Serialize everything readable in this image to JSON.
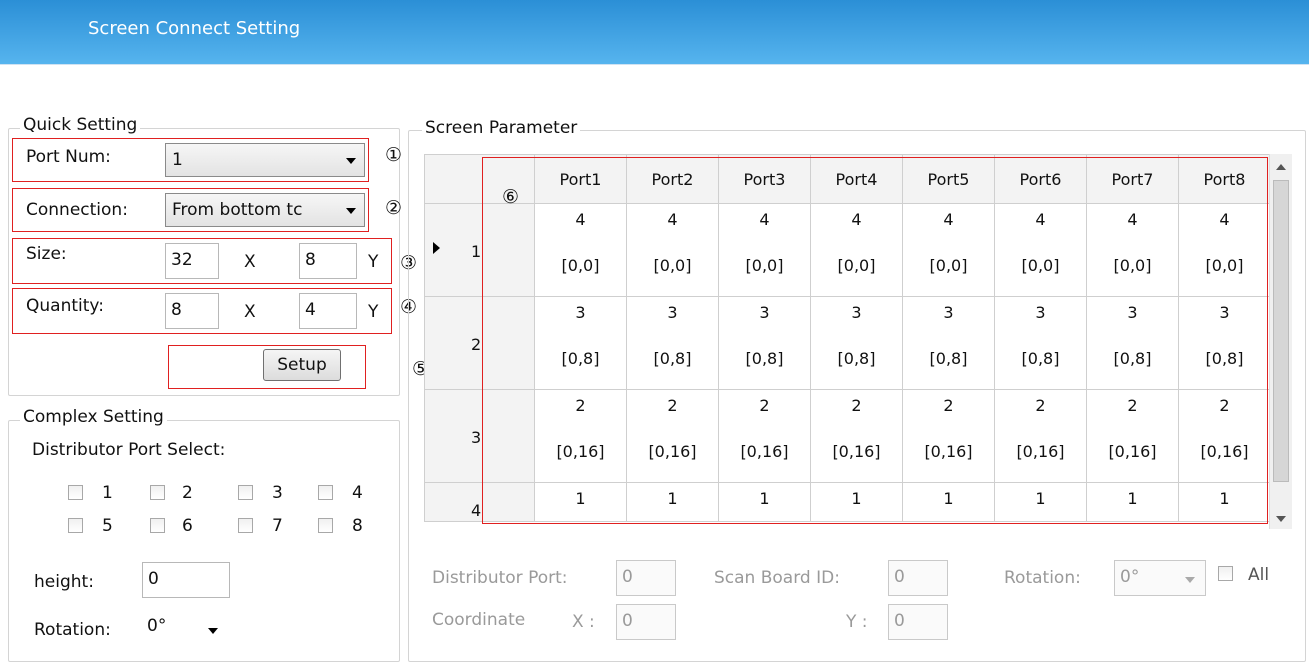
{
  "window": {
    "title": "Screen Connect Setting"
  },
  "quick": {
    "legend": "Quick  Setting",
    "port_num_label": "Port Num:",
    "port_num_value": "1",
    "connection_label": "Connection:",
    "connection_value": "From bottom tc",
    "size_label": "Size:",
    "size_x": "32",
    "size_y": "8",
    "x_sep": "X",
    "y_sep": "Y",
    "quantity_label": "Quantity:",
    "quantity_x": "8",
    "quantity_y": "4",
    "setup_label": "Setup"
  },
  "markers": [
    "①",
    "②",
    "③",
    "④",
    "⑤",
    "⑥"
  ],
  "complex": {
    "legend": "Complex Setting",
    "dist_label": "Distributor Port Select:",
    "ports": [
      "1",
      "2",
      "3",
      "4",
      "5",
      "6",
      "7",
      "8"
    ],
    "height_label": "height:",
    "height_value": "0",
    "rotation_label": "Rotation:",
    "rotation_value": "0°"
  },
  "screen": {
    "legend": "Screen Parameter",
    "columns": [
      "Port1",
      "Port2",
      "Port3",
      "Port4",
      "Port5",
      "Port6",
      "Port7",
      "Port8"
    ],
    "rows": [
      {
        "label": "1",
        "vals": [
          "4",
          "4",
          "4",
          "4",
          "4",
          "4",
          "4",
          "4"
        ],
        "coords": [
          "[0,0]",
          "[0,0]",
          "[0,0]",
          "[0,0]",
          "[0,0]",
          "[0,0]",
          "[0,0]",
          "[0,0]"
        ]
      },
      {
        "label": "2",
        "vals": [
          "3",
          "3",
          "3",
          "3",
          "3",
          "3",
          "3",
          "3"
        ],
        "coords": [
          "[0,8]",
          "[0,8]",
          "[0,8]",
          "[0,8]",
          "[0,8]",
          "[0,8]",
          "[0,8]",
          "[0,8]"
        ]
      },
      {
        "label": "3",
        "vals": [
          "2",
          "2",
          "2",
          "2",
          "2",
          "2",
          "2",
          "2"
        ],
        "coords": [
          "[0,16]",
          "[0,16]",
          "[0,16]",
          "[0,16]",
          "[0,16]",
          "[0,16]",
          "[0,16]",
          "[0,16]"
        ]
      },
      {
        "label": "4",
        "vals": [
          "1",
          "1",
          "1",
          "1",
          "1",
          "1",
          "1",
          "1"
        ],
        "coords": [
          "",
          "",
          "",
          "",
          "",
          "",
          "",
          ""
        ]
      }
    ],
    "dist_port_label": "Distributor Port:",
    "dist_port_value": "0",
    "scan_label": "Scan Board ID:",
    "scan_value": "0",
    "rotation_label": "Rotation:",
    "rotation_value": "0°",
    "all_label": "All",
    "coord_label": "Coordinate",
    "x_label": "X :",
    "x_value": "0",
    "y_label": "Y :",
    "y_value": "0"
  },
  "icons": {
    "row_pointer": "triangle-right-icon",
    "dropdown": "chevron-down-icon"
  }
}
